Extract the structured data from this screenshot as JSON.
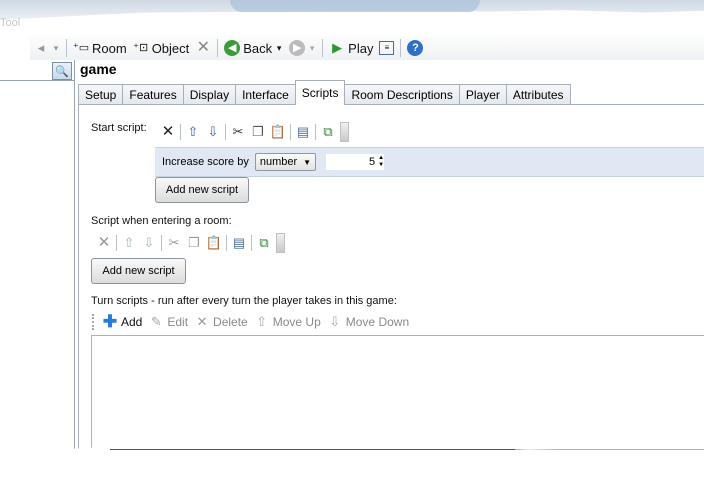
{
  "toolbar": {
    "cut_label": "Tool",
    "room": "Room",
    "object": "Object",
    "back": "Back",
    "play": "Play"
  },
  "tree": {
    "title": "game"
  },
  "tabs": [
    "Setup",
    "Features",
    "Display",
    "Interface",
    "Scripts",
    "Room Descriptions",
    "Player",
    "Attributes"
  ],
  "start_script": {
    "label": "Start script:",
    "row_text": "Increase score by",
    "select_value": "number",
    "spin_value": "5",
    "add_button": "Add new script"
  },
  "room_script": {
    "label": "Script when entering a room:",
    "add_button": "Add new script"
  },
  "turn_scripts": {
    "label": "Turn scripts - run after every turn the player takes in this game:",
    "add": "Add",
    "edit": "Edit",
    "delete": "Delete",
    "move_up": "Move Up",
    "move_down": "Move Down"
  }
}
